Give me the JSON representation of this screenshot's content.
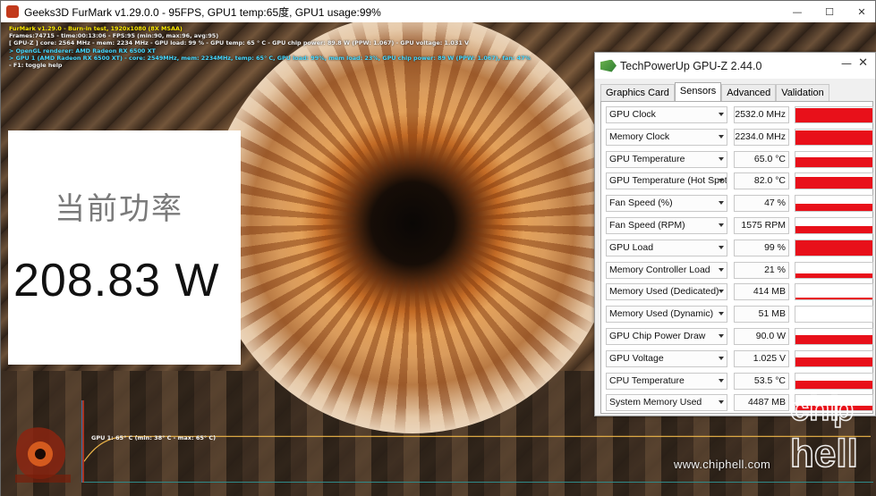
{
  "furmark": {
    "title": "Geeks3D FurMark v1.29.0.0 - 95FPS, GPU1 temp:65度, GPU1 usage:99%",
    "osd_lines": [
      {
        "text": "FurMark v1.29.0 - Burn-in test, 1920x1080 (8X MSAA)",
        "color": "yellow"
      },
      {
        "text": "Frames:74715 - time:00:13:06 - FPS:95 (min:90, max:96, avg:95)",
        "color": "white"
      },
      {
        "text": "[ GPU-Z ] core: 2564 MHz - mem: 2234 MHz - GPU load: 99 % - GPU temp: 65 ° C - GPU chip power: 89.8 W (PPW: 1.067) - GPU voltage: 1.031 V",
        "color": "white"
      },
      {
        "text": "> OpenGL renderer: AMD Radeon RX 6500 XT",
        "color": "cyan"
      },
      {
        "text": "> GPU 1 (AMD Radeon RX 6500 XT) - core: 2549MHz, mem: 2234MHz, temp: 65° C, GPU load: 99%, mem load: 23%, GPU chip power: 89 W (PPW: 1.067), fan: 47%",
        "color": "cyan"
      },
      {
        "text": "- F1: toggle help",
        "color": "white"
      }
    ],
    "graph_label": "GPU 1: 65° C (min: 38° C - max: 65° C)",
    "graph_temp": {
      "min": 38,
      "max": 65,
      "current": 65
    }
  },
  "power_panel": {
    "label": "当前功率",
    "value": "208.83 W"
  },
  "gpuz": {
    "title": "TechPowerUp GPU-Z 2.44.0",
    "tabs": [
      {
        "label": "Graphics Card",
        "active": false
      },
      {
        "label": "Sensors",
        "active": true
      },
      {
        "label": "Advanced",
        "active": false
      },
      {
        "label": "Validation",
        "active": false
      }
    ],
    "sensors": [
      {
        "name": "GPU Clock",
        "value": "2532.0 MHz",
        "level": 0.95
      },
      {
        "name": "Memory Clock",
        "value": "2234.0 MHz",
        "level": 0.95
      },
      {
        "name": "GPU Temperature",
        "value": "65.0 °C",
        "level": 0.65
      },
      {
        "name": "GPU Temperature (Hot Spot)",
        "value": "82.0 °C",
        "level": 0.75
      },
      {
        "name": "Fan Speed (%)",
        "value": "47 %",
        "level": 0.47
      },
      {
        "name": "Fan Speed (RPM)",
        "value": "1575 RPM",
        "level": 0.47
      },
      {
        "name": "GPU Load",
        "value": "99 %",
        "level": 0.99
      },
      {
        "name": "Memory Controller Load",
        "value": "21 %",
        "level": 0.3
      },
      {
        "name": "Memory Used (Dedicated)",
        "value": "414 MB",
        "level": 0.1
      },
      {
        "name": "Memory Used (Dynamic)",
        "value": "51 MB",
        "level": 0.0
      },
      {
        "name": "GPU Chip Power Draw",
        "value": "90.0 W",
        "level": 0.6
      },
      {
        "name": "GPU Voltage",
        "value": "1.025 V",
        "level": 0.6
      },
      {
        "name": "CPU Temperature",
        "value": "53.5 °C",
        "level": 0.5
      },
      {
        "name": "System Memory Used",
        "value": "4487 MB",
        "level": 0.3
      }
    ]
  },
  "watermark": {
    "text": "www.chiphell.com",
    "logo_text": "chip hell"
  },
  "colors": {
    "sensor_bar": "#e8101a",
    "osd_yellow": "#ffea00",
    "osd_cyan": "#46d8ff",
    "graph_line": "#f0b84a"
  }
}
